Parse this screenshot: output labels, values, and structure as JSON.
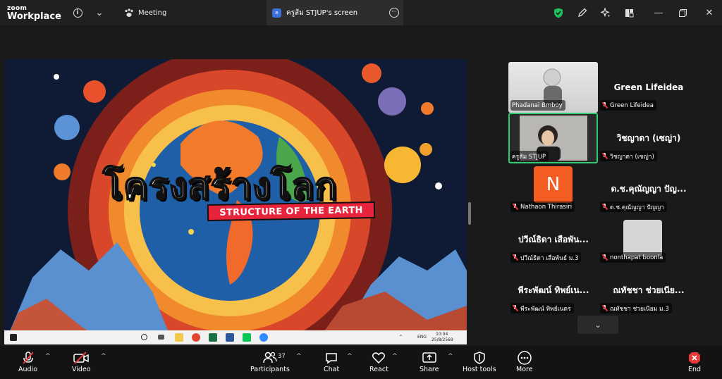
{
  "app": {
    "logo_line1": "zoom",
    "logo_line2": "Workplace"
  },
  "titlebar": {
    "meeting_tab": "Meeting",
    "share_tab": "ครูส้ม STJUP's screen",
    "share_tab_badge": "ค"
  },
  "slide": {
    "title": "โครงสร้างโลก",
    "subtitle": "STRUCTURE OF THE EARTH",
    "taskbar_lang": "ENG",
    "taskbar_time": "10:04",
    "taskbar_date": "25/8/2569"
  },
  "participants": [
    {
      "name": "Phadanai Bmboy",
      "big": "",
      "type": "video"
    },
    {
      "name": "Green Lifeidea",
      "big": "Green Lifeidea",
      "type": "name"
    },
    {
      "name": "ครูส้ม STJUP",
      "big": "",
      "type": "video-active"
    },
    {
      "name": "วิชญาดา (เซญ่า)",
      "big": "วิชญาดา (เซญ่า)",
      "type": "name"
    },
    {
      "name": "Nathaon Thirasiri",
      "big": "N",
      "type": "avatar"
    },
    {
      "name": "ด.ช.คุณัญญา ปัญญา",
      "big": "ด.ช.คุณัญญา ปัญ...",
      "type": "name"
    },
    {
      "name": "ปวีณ์ธิดา เสือพันธ์ ม.3",
      "big": "ปวีณ์ธิดา เสือพัน...",
      "type": "name"
    },
    {
      "name": "nonthapat boonla",
      "big": "",
      "type": "grey"
    },
    {
      "name": "พีระพัฒน์ ทิพย์เนตร",
      "big": "พีระพัฒน์ ทิพย์เน...",
      "type": "name"
    },
    {
      "name": "ณทัชชา ช่วยเนียม ม.3",
      "big": "ณทัชชา ช่วยเนีย...",
      "type": "name"
    }
  ],
  "toolbar": {
    "audio": "Audio",
    "video": "Video",
    "participants": "Participants",
    "participants_count": "37",
    "chat": "Chat",
    "react": "React",
    "share": "Share",
    "host_tools": "Host tools",
    "more": "More",
    "end": "End"
  },
  "colors": {
    "accent_green": "#1fbf5a",
    "end_red": "#e5383b",
    "active_border": "#2ecc71",
    "avatar_orange": "#f45d22"
  }
}
